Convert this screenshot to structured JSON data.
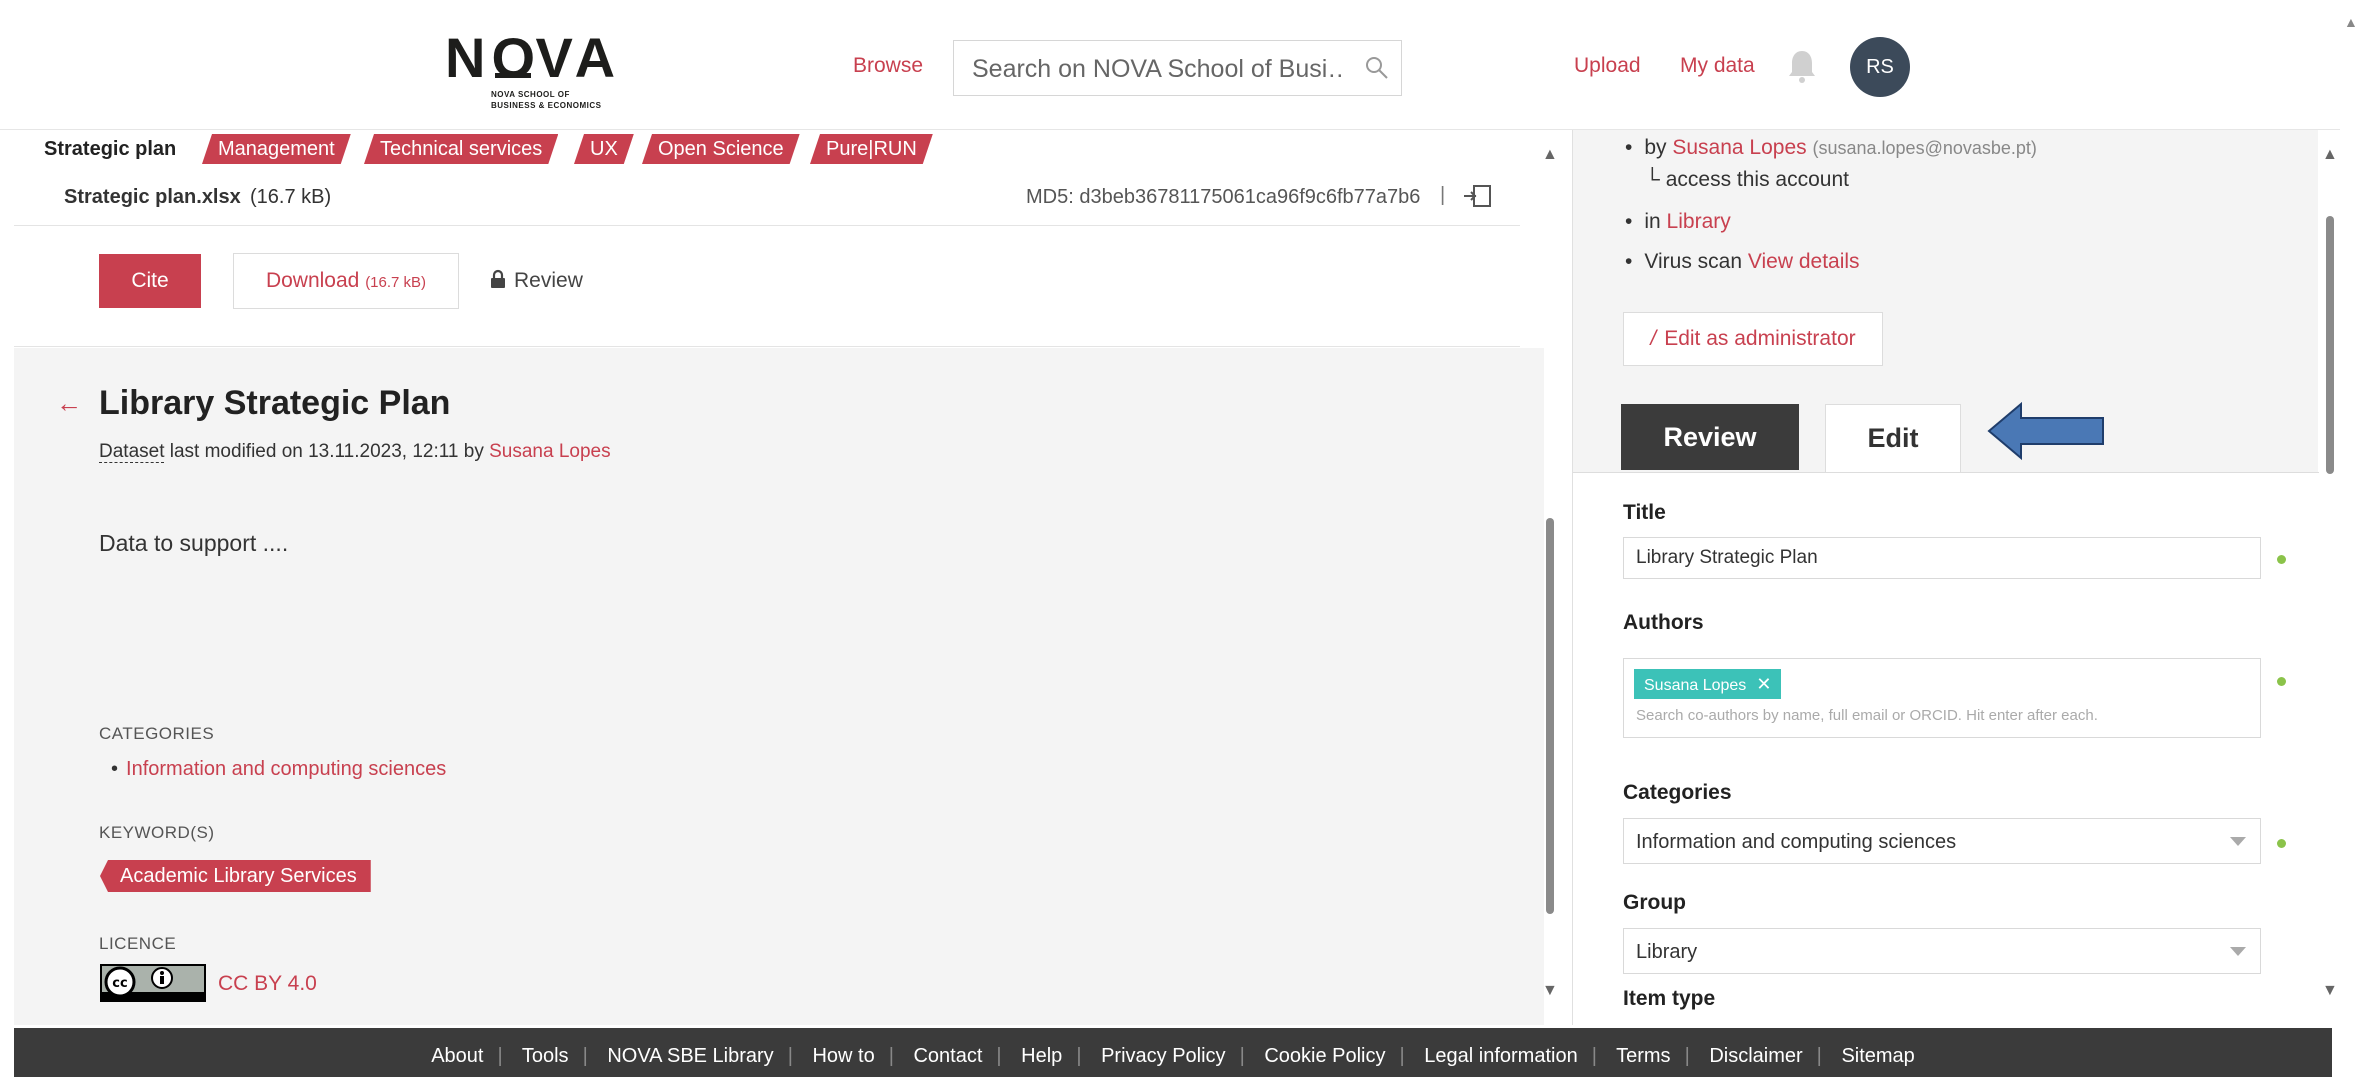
{
  "header": {
    "logo_text_left": "N",
    "logo_text_right": "VA",
    "logo_sub_1": "NOVA SCHOOL OF",
    "logo_sub_2": "BUSINESS & ECONOMICS",
    "browse": "Browse",
    "search_placeholder": "Search on NOVA School of Busi…",
    "upload": "Upload",
    "my_data": "My data",
    "avatar_initials": "RS"
  },
  "tabs": [
    "Strategic plan",
    "Management",
    "Technical services",
    "UX",
    "Open Science",
    "Pure|RUN"
  ],
  "file": {
    "name": "Strategic plan.xlsx",
    "size": "(16.7 kB)",
    "md5": "MD5: d3beb36781175061ca96f9c6fb77a7b6",
    "sep": "|"
  },
  "actions": {
    "cite": "Cite",
    "download": "Download",
    "download_size": "(16.7 kB)",
    "review": "Review"
  },
  "dataset": {
    "back": "←",
    "title": "Library Strategic Plan",
    "type": "Dataset",
    "modified": " last modified on 13.11.2023, 12:11 by ",
    "author": "Susana Lopes",
    "description": "Data to support ....",
    "categories_label": "CATEGORIES",
    "category": "Information and computing sciences",
    "keywords_label": "KEYWORD(S)",
    "keyword": "Academic Library Services",
    "licence_label": "LICENCE",
    "licence": "CC BY 4.0"
  },
  "sidebar": {
    "by_prefix": "by ",
    "owner": "Susana Lopes",
    "owner_email": "(susana.lopes@novasbe.pt)",
    "access_account": "└ access this account",
    "in_prefix": "in ",
    "group": "Library",
    "virus_prefix": "Virus scan ",
    "view_details": "View details",
    "edit_admin": "Edit as administrator",
    "tab_review": "Review",
    "tab_edit": "Edit"
  },
  "form": {
    "title_label": "Title",
    "title_value": "Library Strategic Plan",
    "authors_label": "Authors",
    "author_chip": "Susana Lopes",
    "authors_hint": "Search co-authors by name, full email or ORCID. Hit enter after each.",
    "categories_label": "Categories",
    "categories_value": "Information and computing sciences",
    "group_label": "Group",
    "group_value": "Library",
    "item_type_label": "Item type"
  },
  "footer": [
    "About",
    "Tools",
    "NOVA SBE Library",
    "How to",
    "Contact",
    "Help",
    "Privacy Policy",
    "Cookie Policy",
    "Legal information",
    "Terms",
    "Disclaimer",
    "Sitemap"
  ],
  "colors": {
    "accent": "#c8404f",
    "dark": "#3b3b3b",
    "teal_chip": "#3cc2b8",
    "valid_dot": "#8bc34a",
    "annotation_arrow": "#4a78b5"
  }
}
